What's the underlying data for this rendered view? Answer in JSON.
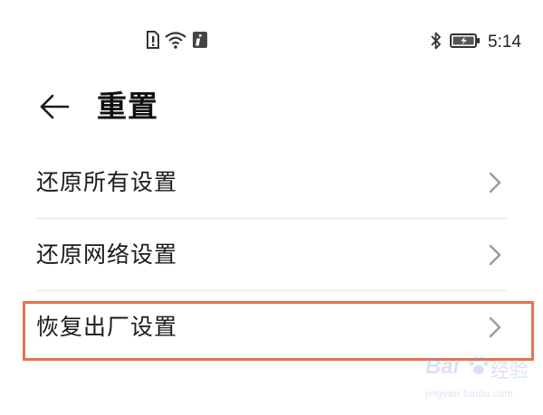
{
  "status_bar": {
    "left_icons": [
      "alert-sim-icon",
      "wifi-icon",
      "info-icon"
    ],
    "right_icons": [
      "bluetooth-icon",
      "battery-charging-icon"
    ],
    "time": "5:14"
  },
  "header": {
    "back_icon": "arrow-left-icon",
    "title": "重置"
  },
  "list": {
    "items": [
      {
        "label": "还原所有设置",
        "icon": "chevron-right-icon"
      },
      {
        "label": "还原网络设置",
        "icon": "chevron-right-icon"
      },
      {
        "label": "恢复出厂设置",
        "icon": "chevron-right-icon"
      }
    ]
  },
  "highlight": {
    "color": "#e8734c",
    "target": "恢复出厂设置"
  },
  "watermark": {
    "brand": "Bai",
    "suffix": "经验",
    "url": "jingyan.baidu.com"
  },
  "colors": {
    "divider": "#e4e4e4",
    "text": "#1a1a1a",
    "chevron": "#9a9a9a"
  }
}
